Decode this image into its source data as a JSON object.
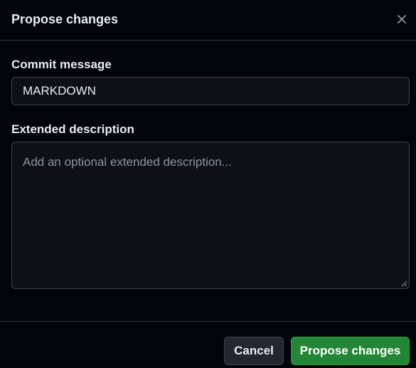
{
  "dialog": {
    "title": "Propose changes",
    "close_icon": "x-icon"
  },
  "commit": {
    "label": "Commit message",
    "value": "MARKDOWN"
  },
  "extended": {
    "label": "Extended description",
    "placeholder": "Add an optional extended description...",
    "value": ""
  },
  "footer": {
    "cancel_label": "Cancel",
    "submit_label": "Propose changes"
  },
  "colors": {
    "background": "#010409",
    "input_background": "#0d1117",
    "border": "#3d444d",
    "primary": "#238636",
    "text": "#e6edf3",
    "placeholder": "#8b949e"
  }
}
